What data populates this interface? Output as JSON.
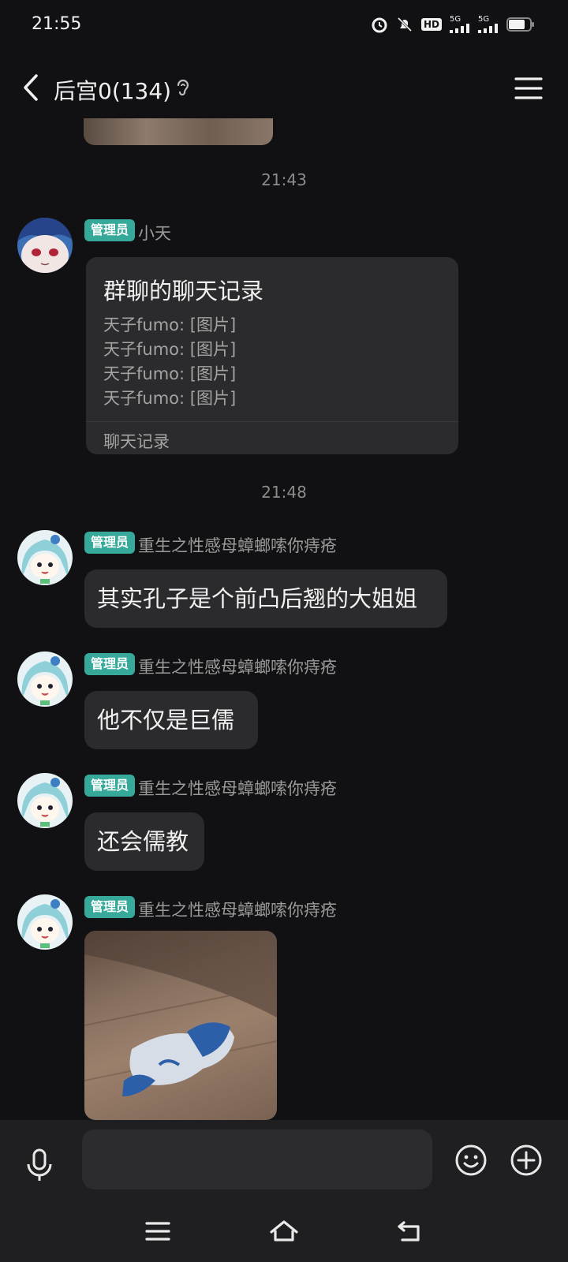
{
  "status_bar": {
    "time": "21:55",
    "signal_1": "5G",
    "signal_2": "5G",
    "hd_label": "HD"
  },
  "header": {
    "title": "后宫0(134)"
  },
  "timestamps": [
    "21:43",
    "21:48"
  ],
  "messages": [
    {
      "badge": "管理员",
      "sender": "小天",
      "type": "forward_card",
      "card": {
        "title": "群聊的聊天记录",
        "lines": [
          "天子fumo: [图片]",
          "天子fumo: [图片]",
          "天子fumo: [图片]",
          "天子fumo: [图片]"
        ],
        "footer": "聊天记录"
      }
    },
    {
      "badge": "管理员",
      "sender": "重生之性感母蟑螂嗦你痔疮",
      "type": "text",
      "text": "其实孔子是个前凸后翘的大姐姐"
    },
    {
      "badge": "管理员",
      "sender": "重生之性感母蟑螂嗦你痔疮",
      "type": "text",
      "text": "他不仅是巨儒"
    },
    {
      "badge": "管理员",
      "sender": "重生之性感母蟑螂嗦你痔疮",
      "type": "text",
      "text": "还会儒教"
    },
    {
      "badge": "管理员",
      "sender": "重生之性感母蟑螂嗦你痔疮",
      "type": "image"
    }
  ],
  "input_bar": {
    "placeholder": ""
  },
  "icons": {
    "back": "back-arrow-icon",
    "ear": "ear-icon",
    "menu": "hamburger-menu-icon",
    "mic": "microphone-icon",
    "emoji": "emoji-icon",
    "plus": "plus-circle-icon",
    "nav_menu": "nav-menu-icon",
    "nav_home": "nav-home-icon",
    "nav_back": "nav-back-icon"
  },
  "colors": {
    "background": "#111113",
    "bubble": "#2b2b2d",
    "badge": "#36a99a",
    "bar": "#1f1f21"
  }
}
